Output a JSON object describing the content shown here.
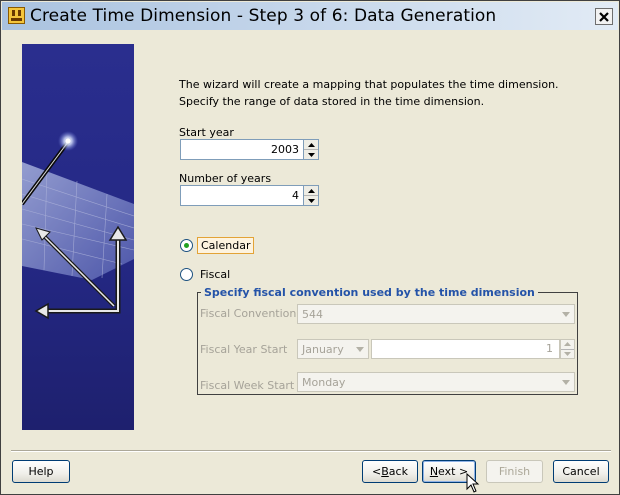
{
  "window": {
    "title": "Create Time Dimension - Step 3 of 6: Data Generation",
    "app_icon": "wizard-app-icon",
    "close_icon": "close-icon"
  },
  "intro": {
    "text": "The wizard will create a mapping that populates the time dimension. Specify the range of data stored in the time dimension."
  },
  "start_year": {
    "label": "Start year",
    "value": "2003"
  },
  "num_years": {
    "label": "Number of years",
    "value": "4"
  },
  "range_type": {
    "calendar_label": "Calendar",
    "fiscal_label": "Fiscal",
    "selected": "Calendar"
  },
  "fiscal_group": {
    "title": "Specify fiscal convention used by the time dimension",
    "convention_label": "Fiscal Convention",
    "convention_value": "544",
    "year_start_label": "Fiscal Year Start",
    "year_start_month": "January",
    "year_start_day": "1",
    "week_start_label": "Fiscal Week Start",
    "week_start_value": "Monday"
  },
  "buttons": {
    "help": "Help",
    "back_mnemonic": "< ",
    "back_u": "B",
    "back_rest": "ack",
    "next_u": "N",
    "next_rest": "ext >",
    "finish": "Finish",
    "cancel": "Cancel"
  },
  "colors": {
    "dialog_bg": "#ECE9D8",
    "group_title": "#2453A8",
    "sidebar_bg": "#242884"
  }
}
